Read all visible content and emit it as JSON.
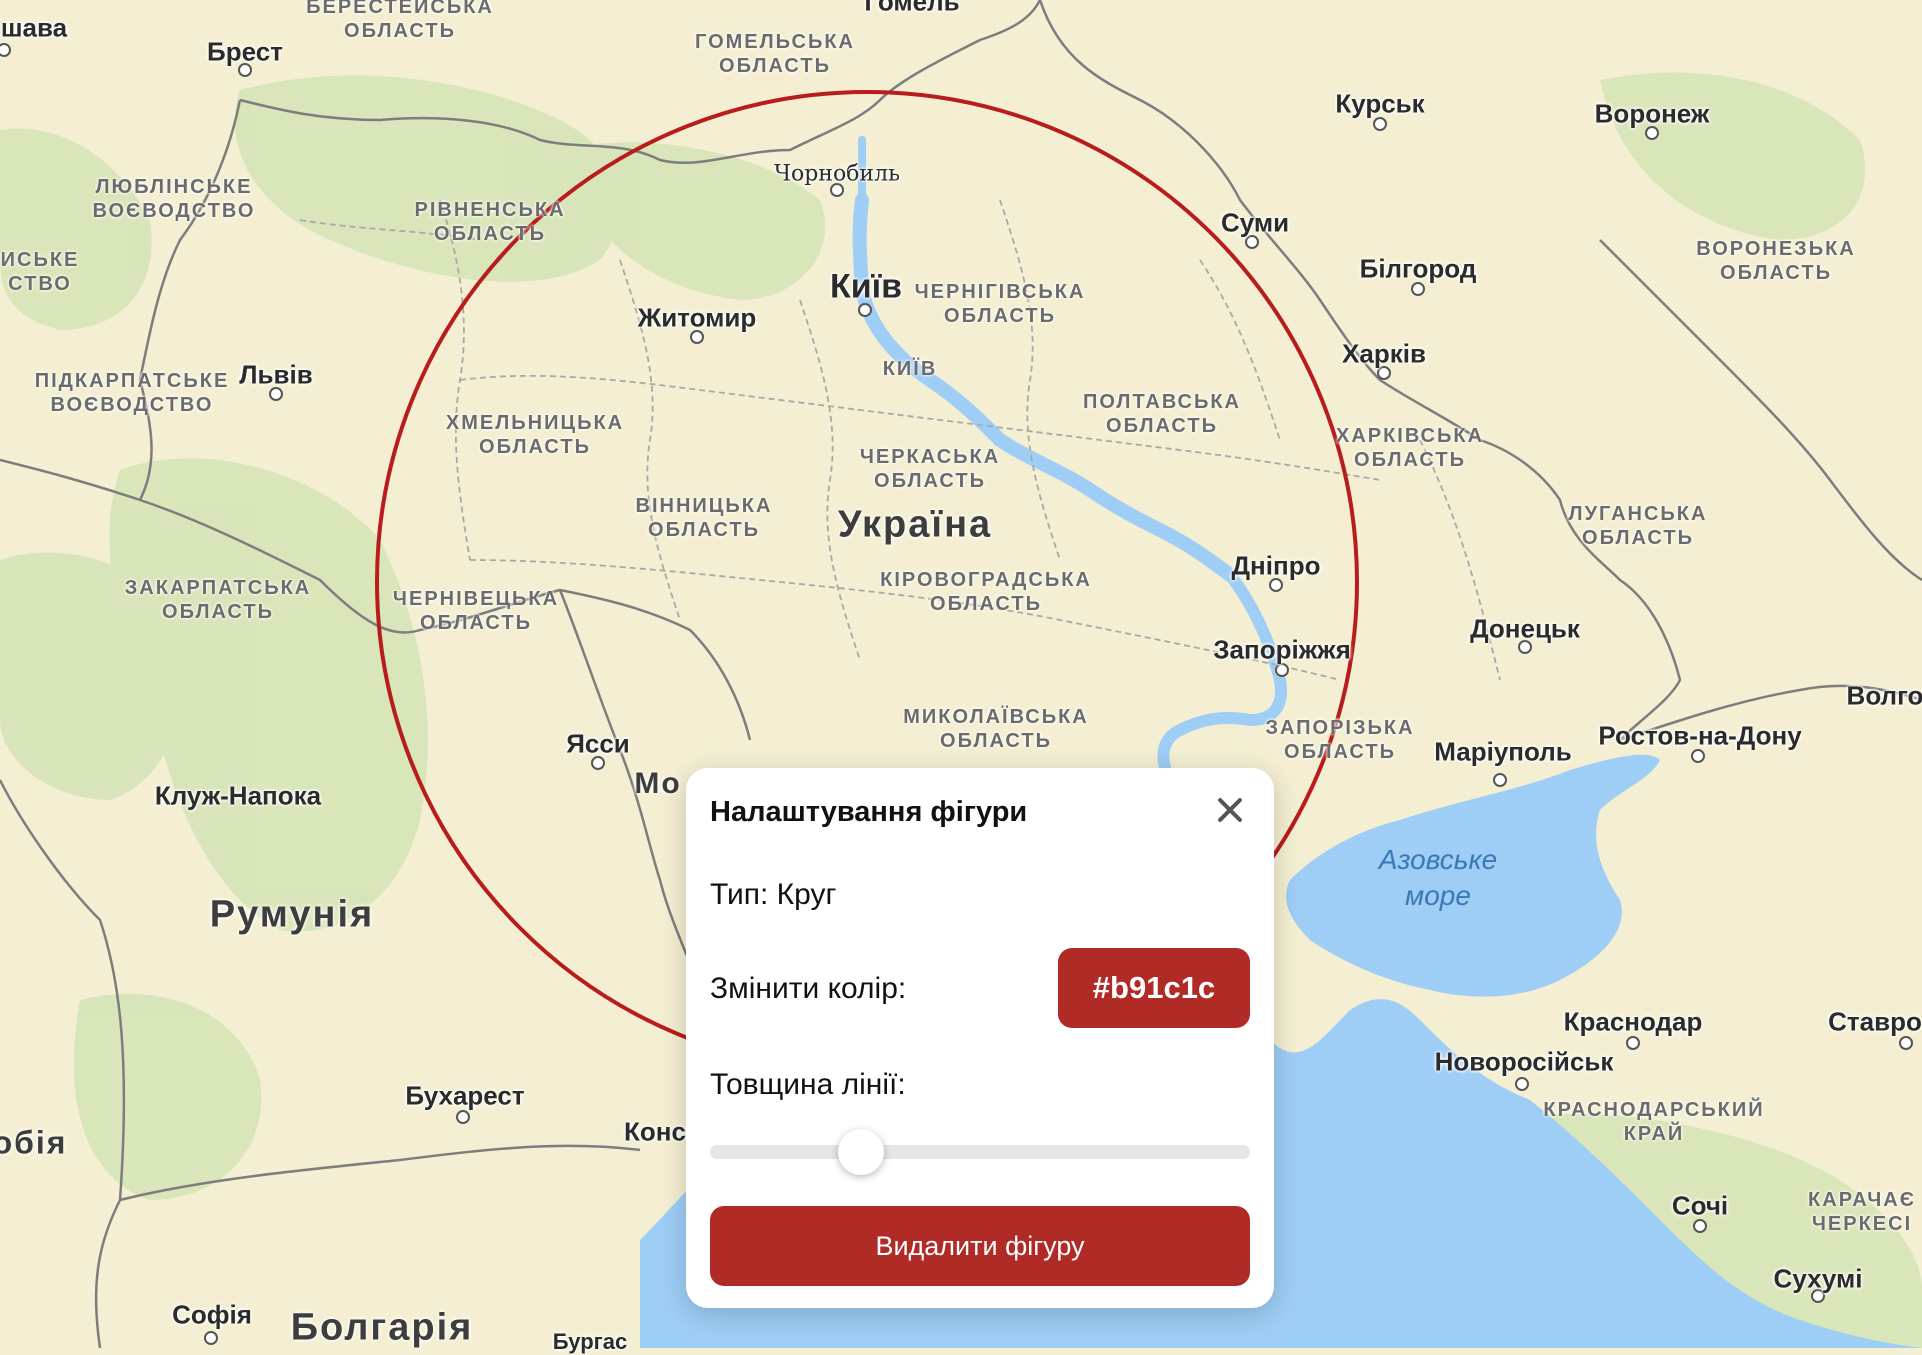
{
  "map": {
    "country_labels": [
      {
        "id": "ukraine",
        "text": "Україна"
      },
      {
        "id": "romania",
        "text": "Румунія"
      },
      {
        "id": "bulgaria",
        "text": "Болгарія"
      },
      {
        "id": "serbia",
        "text": "обія"
      },
      {
        "id": "moldova",
        "text": "Мо"
      }
    ],
    "cities": [
      {
        "id": "kyiv",
        "text": "Київ"
      },
      {
        "id": "zhytomyr",
        "text": "Житомир"
      },
      {
        "id": "lviv",
        "text": "Львів"
      },
      {
        "id": "chornobyl",
        "text": "Чорнобиль"
      },
      {
        "id": "brest",
        "text": "Брест"
      },
      {
        "id": "homel",
        "text": "Гомель"
      },
      {
        "id": "varshava",
        "text": "шава"
      },
      {
        "id": "kursk",
        "text": "Курськ"
      },
      {
        "id": "voronezh",
        "text": "Воронеж"
      },
      {
        "id": "sumy",
        "text": "Суми"
      },
      {
        "id": "bilhorod",
        "text": "Білгород"
      },
      {
        "id": "kharkiv",
        "text": "Харків"
      },
      {
        "id": "dnipro",
        "text": "Дніпро"
      },
      {
        "id": "zaporizhzhia",
        "text": "Запоріжжя"
      },
      {
        "id": "donetsk",
        "text": "Донецьк"
      },
      {
        "id": "mariupol",
        "text": "Маріуполь"
      },
      {
        "id": "rostov",
        "text": "Ростов-на-Дону"
      },
      {
        "id": "volgo",
        "text": "Волго"
      },
      {
        "id": "krasnodar",
        "text": "Краснодар"
      },
      {
        "id": "stavro",
        "text": "Ставро"
      },
      {
        "id": "novorossiysk",
        "text": "Новоросійськ"
      },
      {
        "id": "sochi",
        "text": "Сочі"
      },
      {
        "id": "sukhumi",
        "text": "Сухумі"
      },
      {
        "id": "iasi",
        "text": "Ясси"
      },
      {
        "id": "cluj",
        "text": "Клуж-Напока"
      },
      {
        "id": "bucharest",
        "text": "Бухарест"
      },
      {
        "id": "konst",
        "text": "Конс"
      },
      {
        "id": "sofia",
        "text": "Софія"
      },
      {
        "id": "burgas",
        "text": "Бургас"
      },
      {
        "id": "kyiv-region",
        "text": "КИЇВ"
      }
    ],
    "regions": [
      {
        "id": "brest-oblast",
        "text": "БЕРЕСТЕЙСЬКА\nОБЛАСТЬ"
      },
      {
        "id": "homel-oblast",
        "text": "ГОМЕЛЬСЬКА\nОБЛАСТЬ"
      },
      {
        "id": "lublin",
        "text": "ЛЮБЛІНСЬКЕ\nВОЄВОДСТВО"
      },
      {
        "id": "rivne",
        "text": "РІВНЕНСЬКА\nОБЛАСТЬ"
      },
      {
        "id": "mazovia",
        "text": "ИСЬКЕ\nСТВО"
      },
      {
        "id": "chernihiv",
        "text": "ЧЕРНІГІВСЬКА\nОБЛАСТЬ"
      },
      {
        "id": "pidkarpattia",
        "text": "ПІДКАРПАТСЬКЕ\nВОЄВОДСТВО"
      },
      {
        "id": "khmelnytskyi",
        "text": "ХМЕЛЬНИЦЬКА\nОБЛАСТЬ"
      },
      {
        "id": "poltava",
        "text": "ПОЛТАВСЬКА\nОБЛАСТЬ"
      },
      {
        "id": "voronezh-oblast",
        "text": "ВОРОНЕЗЬКА\nОБЛАСТЬ"
      },
      {
        "id": "cherkasy",
        "text": "ЧЕРКАСЬКА\nОБЛАСТЬ"
      },
      {
        "id": "vinnytsia",
        "text": "ВІННИЦЬКА\nОБЛАСТЬ"
      },
      {
        "id": "kharkiv-oblast",
        "text": "ХАРКІВСЬКА\nОБЛАСТЬ"
      },
      {
        "id": "luhansk",
        "text": "ЛУГАНСЬКА\nОБЛАСТЬ"
      },
      {
        "id": "zakarpattia",
        "text": "ЗАКАРПАТСЬКА\nОБЛАСТЬ"
      },
      {
        "id": "kirovohrad",
        "text": "КІРОВОГРАДСЬКА\nОБЛАСТЬ"
      },
      {
        "id": "chernivtsi",
        "text": "ЧЕРНІВЕЦЬКА\nОБЛАСТЬ"
      },
      {
        "id": "mykolaiv",
        "text": "МИКОЛАЇВСЬКА\nОБЛАСТЬ"
      },
      {
        "id": "zaporizhzhia-oblast",
        "text": "ЗАПОРІЗЬКА\nОБЛАСТЬ"
      },
      {
        "id": "krasnodar-krai",
        "text": "КРАСНОДАРСЬКИЙ\nКРАЙ"
      },
      {
        "id": "karachay",
        "text": "КАРАЧАЄ\nЧЕРКЕСІ"
      }
    ],
    "seas": [
      {
        "id": "azov",
        "text": "Азовське\nморе"
      }
    ],
    "shape": {
      "type": "circle",
      "stroke_color": "#b91c1c"
    }
  },
  "popup": {
    "title": "Налаштування фігури",
    "type_text": "Тип: Круг",
    "color_label": "Змінити колір:",
    "color_value": "#b91c1c",
    "thickness_label": "Товщина лінії:",
    "thickness_fraction": 0.28,
    "delete_label": "Видалити фігуру",
    "accent": "#b02a26"
  },
  "colors": {
    "land": "#f4efd2",
    "forest": "#cfe2b4",
    "water": "#9ecdf5",
    "border": "#7d7d7d"
  }
}
